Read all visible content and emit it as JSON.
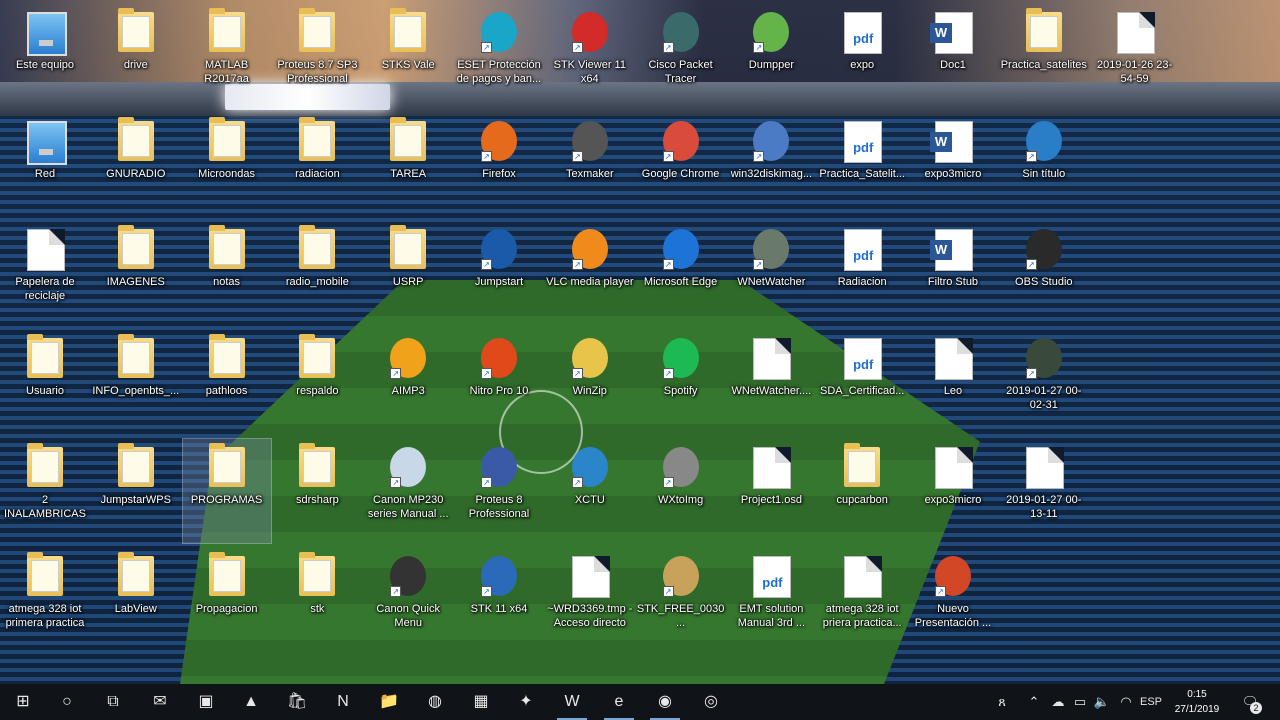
{
  "desktop": {
    "icons": [
      {
        "label": "Este equipo",
        "icon": "computer-icon",
        "type": "pc"
      },
      {
        "label": "drive",
        "icon": "folder-icon",
        "type": "folder"
      },
      {
        "label": "MATLAB R2017aa",
        "icon": "matlab-icon",
        "type": "folder"
      },
      {
        "label": "Proteus 8.7 SP3 Professional",
        "icon": "folder-icon",
        "type": "folder"
      },
      {
        "label": "STKS Vale",
        "icon": "folder-icon",
        "type": "folder"
      },
      {
        "label": "ESET Protección de pagos y ban...",
        "icon": "eset-icon",
        "type": "app",
        "color": "#19a6c9"
      },
      {
        "label": "STK Viewer 11 x64",
        "icon": "stk-viewer-icon",
        "type": "app",
        "color": "#d32a2a"
      },
      {
        "label": "Cisco Packet Tracer",
        "icon": "cisco-icon",
        "type": "app",
        "color": "#3a6a6a"
      },
      {
        "label": "Dumpper",
        "icon": "dumpper-icon",
        "type": "app",
        "color": "#64b44a"
      },
      {
        "label": "expo",
        "icon": "pdf-icon",
        "type": "pdf"
      },
      {
        "label": "Doc1",
        "icon": "word-icon",
        "type": "word"
      },
      {
        "label": "Practica_satelites",
        "icon": "folder-icon",
        "type": "folder"
      },
      {
        "label": "2019-01-26 23-54-59",
        "icon": "video-file-icon",
        "type": "doc"
      },
      {
        "label": "Red",
        "icon": "network-icon",
        "type": "pc"
      },
      {
        "label": "GNURADIO",
        "icon": "folder-icon",
        "type": "folder"
      },
      {
        "label": "Microondas",
        "icon": "folder-icon",
        "type": "folder"
      },
      {
        "label": "radiacion",
        "icon": "folder-icon",
        "type": "folder"
      },
      {
        "label": "TAREA",
        "icon": "folder-icon",
        "type": "folder"
      },
      {
        "label": "Firefox",
        "icon": "firefox-icon",
        "type": "app",
        "color": "#e66a1c"
      },
      {
        "label": "Texmaker",
        "icon": "texmaker-icon",
        "type": "app",
        "color": "#555"
      },
      {
        "label": "Google Chrome",
        "icon": "chrome-icon",
        "type": "app",
        "color": "#d94b3a"
      },
      {
        "label": "win32diskimag...",
        "icon": "disk-imager-icon",
        "type": "app",
        "color": "#4a7bc4"
      },
      {
        "label": "Practica_Satelit...",
        "icon": "pdf-icon",
        "type": "pdf"
      },
      {
        "label": "expo3micro",
        "icon": "word-icon",
        "type": "word"
      },
      {
        "label": "Sin título",
        "icon": "cst-icon",
        "type": "app",
        "color": "#2a7ec8"
      },
      {
        "label": "Papelera de reciclaje",
        "icon": "recycle-bin-icon",
        "type": "doc"
      },
      {
        "label": "IMAGENES",
        "icon": "folder-icon",
        "type": "folder"
      },
      {
        "label": "notas",
        "icon": "folder-icon",
        "type": "folder"
      },
      {
        "label": "radio_mobile",
        "icon": "folder-icon",
        "type": "folder"
      },
      {
        "label": "USRP",
        "icon": "folder-icon",
        "type": "folder"
      },
      {
        "label": "Jumpstart",
        "icon": "jumpstart-icon",
        "type": "app",
        "color": "#1a5aa8"
      },
      {
        "label": "VLC media player",
        "icon": "vlc-icon",
        "type": "app",
        "color": "#f08a1a"
      },
      {
        "label": "Microsoft Edge",
        "icon": "edge-icon",
        "type": "app",
        "color": "#1d73d6"
      },
      {
        "label": "WNetWatcher",
        "icon": "wnetwatcher-icon",
        "type": "app",
        "color": "#6a7a6a"
      },
      {
        "label": "Radiacion",
        "icon": "pdf-icon",
        "type": "pdf"
      },
      {
        "label": "Filtro Stub",
        "icon": "word-icon",
        "type": "word"
      },
      {
        "label": "OBS Studio",
        "icon": "obs-icon",
        "type": "app",
        "color": "#2a2a2a"
      },
      {
        "label": "Usuario",
        "icon": "user-folder-icon",
        "type": "folder"
      },
      {
        "label": "INFO_openbts_...",
        "icon": "folder-icon",
        "type": "folder"
      },
      {
        "label": "pathloos",
        "icon": "folder-icon",
        "type": "folder"
      },
      {
        "label": "respaldo",
        "icon": "folder-icon",
        "type": "folder"
      },
      {
        "label": "AIMP3",
        "icon": "aimp-icon",
        "type": "app",
        "color": "#f0a21a"
      },
      {
        "label": "Nitro Pro 10",
        "icon": "nitro-icon",
        "type": "app",
        "color": "#e04a1a"
      },
      {
        "label": "WinZip",
        "icon": "winzip-icon",
        "type": "app",
        "color": "#e8c44a"
      },
      {
        "label": "Spotify",
        "icon": "spotify-icon",
        "type": "app",
        "color": "#1db954"
      },
      {
        "label": "WNetWatcher....",
        "icon": "file-icon",
        "type": "doc"
      },
      {
        "label": "SDA_Certificad...",
        "icon": "pdf-icon",
        "type": "pdf"
      },
      {
        "label": "Leo",
        "icon": "text-file-icon",
        "type": "doc"
      },
      {
        "label": "2019-01-27 00-02-31",
        "icon": "video-file-icon",
        "type": "app",
        "color": "#3a4a3a"
      },
      {
        "label": "2 INALAMBRICAS",
        "icon": "folder-icon",
        "type": "folder"
      },
      {
        "label": "JumpstarWPS",
        "icon": "folder-icon",
        "type": "folder"
      },
      {
        "label": "PROGRAMAS",
        "icon": "folder-icon",
        "type": "folder",
        "selected": true
      },
      {
        "label": "sdrsharp",
        "icon": "folder-icon",
        "type": "folder"
      },
      {
        "label": "Canon MP230 series Manual ...",
        "icon": "canon-manual-icon",
        "type": "app",
        "color": "#c8d8e8"
      },
      {
        "label": "Proteus 8 Professional",
        "icon": "proteus-icon",
        "type": "app",
        "color": "#3a5aa8"
      },
      {
        "label": "XCTU",
        "icon": "xctu-icon",
        "type": "app",
        "color": "#2a86c8"
      },
      {
        "label": "WXtoImg",
        "icon": "wxtoimg-icon",
        "type": "app",
        "color": "#888"
      },
      {
        "label": "Project1.osd",
        "icon": "file-icon",
        "type": "doc"
      },
      {
        "label": "cupcarbon",
        "icon": "cupcarbon-icon",
        "type": "folder"
      },
      {
        "label": "expo3micro",
        "icon": "ppt-file-icon",
        "type": "doc"
      },
      {
        "label": "2019-01-27 00-13-11",
        "icon": "video-file-icon",
        "type": "doc"
      },
      {
        "label": "atmega 328 iot primera practica",
        "icon": "folder-icon",
        "type": "folder"
      },
      {
        "label": "LabView",
        "icon": "labview-folder-icon",
        "type": "folder"
      },
      {
        "label": "Propagacion",
        "icon": "folder-icon",
        "type": "folder"
      },
      {
        "label": "stk",
        "icon": "folder-icon",
        "type": "folder"
      },
      {
        "label": "Canon Quick Menu",
        "icon": "canon-quick-menu-icon",
        "type": "app",
        "color": "#333"
      },
      {
        "label": "STK 11 x64",
        "icon": "stk-icon",
        "type": "app",
        "color": "#2a6ab8"
      },
      {
        "label": "~WRD3369.tmp - Acceso directo",
        "icon": "file-icon",
        "type": "doc"
      },
      {
        "label": "STK_FREE_0030...",
        "icon": "stk-free-icon",
        "type": "app",
        "color": "#c8a25a"
      },
      {
        "label": "EMT solution Manual 3rd ...",
        "icon": "pdf-icon",
        "type": "pdf"
      },
      {
        "label": "atmega 328 iot priera practica...",
        "icon": "file-icon",
        "type": "doc"
      },
      {
        "label": "Nuevo Presentación ...",
        "icon": "powerpoint-icon",
        "type": "app",
        "color": "#d24726"
      }
    ]
  },
  "taskbar": {
    "items": [
      {
        "name": "start-button",
        "glyph": "⊞",
        "interactable": true
      },
      {
        "name": "search-button",
        "glyph": "○",
        "interactable": true
      },
      {
        "name": "task-view-button",
        "glyph": "⧉",
        "interactable": true
      },
      {
        "name": "taskbar-mail",
        "glyph": "✉",
        "interactable": true
      },
      {
        "name": "taskbar-proteus",
        "glyph": "▣",
        "interactable": true
      },
      {
        "name": "taskbar-matlab",
        "glyph": "▲",
        "interactable": true
      },
      {
        "name": "taskbar-store",
        "glyph": "🛍",
        "interactable": true
      },
      {
        "name": "taskbar-netflix",
        "glyph": "N",
        "interactable": true
      },
      {
        "name": "taskbar-file-explorer",
        "glyph": "📁",
        "interactable": true
      },
      {
        "name": "taskbar-app-globe",
        "glyph": "◍",
        "interactable": true
      },
      {
        "name": "taskbar-app-photos",
        "glyph": "▦",
        "interactable": true
      },
      {
        "name": "taskbar-app-teal",
        "glyph": "✦",
        "interactable": true
      },
      {
        "name": "taskbar-word",
        "glyph": "W",
        "interactable": true
      },
      {
        "name": "taskbar-edge",
        "glyph": "e",
        "interactable": true
      },
      {
        "name": "taskbar-firefox",
        "glyph": "◉",
        "interactable": true
      },
      {
        "name": "taskbar-obs",
        "glyph": "◎",
        "interactable": true
      }
    ],
    "tray": {
      "language": "ESP",
      "time": "0:15",
      "date": "27/1/2019",
      "notifications": "2"
    }
  }
}
